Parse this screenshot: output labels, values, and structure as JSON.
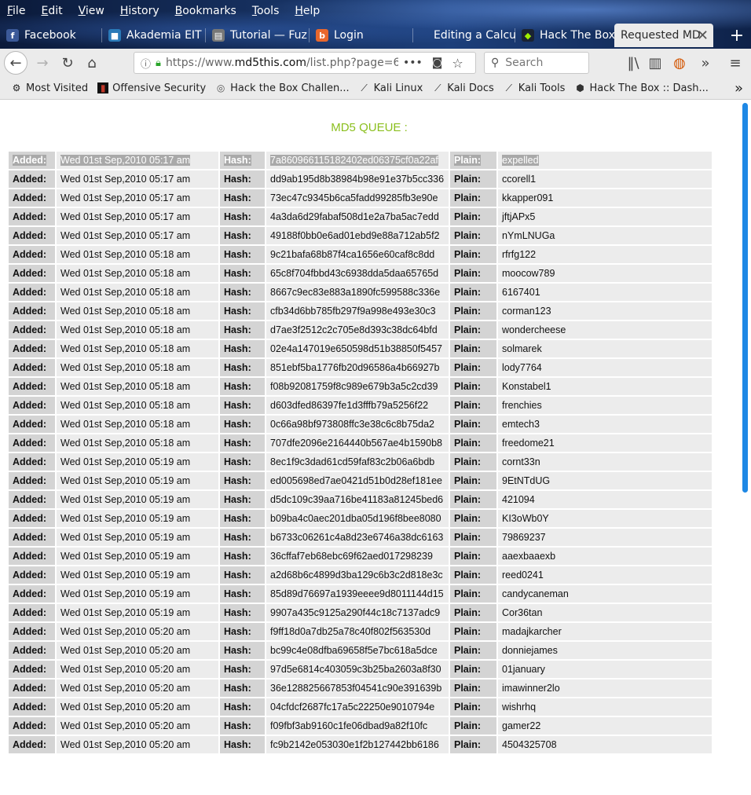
{
  "menu": [
    "File",
    "Edit",
    "View",
    "History",
    "Bookmarks",
    "Tools",
    "Help"
  ],
  "tabs": [
    {
      "label": "Facebook",
      "icon": "facebook-icon",
      "color": "#3b5998",
      "glyph": "f"
    },
    {
      "label": "Akademia EIT",
      "icon": "akademia-icon",
      "color": "#2a7ab8",
      "glyph": "■"
    },
    {
      "label": "Tutorial — Fuz",
      "icon": "tutorial-icon",
      "color": "#777777",
      "glyph": "▤"
    },
    {
      "label": "Login",
      "icon": "burp-icon",
      "color": "#e8672d",
      "glyph": "b"
    },
    {
      "label": "",
      "icon": "blank-tab-icon",
      "color": "#1d3f7a",
      "glyph": ""
    },
    {
      "label": "Editing a Calcu",
      "icon": "calc-icon",
      "color": "#1d3f7a",
      "glyph": ""
    },
    {
      "label": "Hack The Box",
      "icon": "htb-icon",
      "color": "#9fef00",
      "glyph": "◆"
    },
    {
      "label": "Requested MD",
      "icon": "page-icon",
      "color": "#ebebeb",
      "glyph": ""
    }
  ],
  "url": {
    "pre": "https://www.",
    "domain": "md5this.com",
    "path": "/list.php?page=6("
  },
  "search_placeholder": "Search",
  "bookmarks": [
    {
      "label": "Most Visited",
      "icon": "gear-icon"
    },
    {
      "label": "Offensive Security",
      "icon": "offsec-icon"
    },
    {
      "label": "Hack the Box Challen...",
      "icon": "globe-icon"
    },
    {
      "label": "Kali Linux",
      "icon": "kali-icon"
    },
    {
      "label": "Kali Docs",
      "icon": "kali-icon"
    },
    {
      "label": "Kali Tools",
      "icon": "kali-icon"
    },
    {
      "label": "Hack The Box :: Dash...",
      "icon": "htb-icon"
    }
  ],
  "heading": "MD5 QUEUE :",
  "labels": {
    "added": "Added:",
    "hash": "Hash:",
    "plain": "Plain:"
  },
  "rows": [
    [
      "Wed 01st Sep,2010 05:17 am",
      "7a860966115182402ed06375cf0a22af",
      "expelled"
    ],
    [
      "Wed 01st Sep,2010 05:17 am",
      "dd9ab195d8b38984b98e91e37b5cc336",
      "ccorell1"
    ],
    [
      "Wed 01st Sep,2010 05:17 am",
      "73ec47c9345b6ca5fadd99285fb3e90e",
      "kkapper091"
    ],
    [
      "Wed 01st Sep,2010 05:17 am",
      "4a3da6d29fabaf508d1e2a7ba5ac7edd",
      "jftjAPx5"
    ],
    [
      "Wed 01st Sep,2010 05:17 am",
      "49188f0bb0e6ad01ebd9e88a712ab5f2",
      "nYmLNUGa"
    ],
    [
      "Wed 01st Sep,2010 05:18 am",
      "9c21bafa68b87f4ca1656e60caf8c8dd",
      "rfrfg122"
    ],
    [
      "Wed 01st Sep,2010 05:18 am",
      "65c8f704fbbd43c6938dda5daa65765d",
      "moocow789"
    ],
    [
      "Wed 01st Sep,2010 05:18 am",
      "8667c9ec83e883a1890fc599588c336e",
      "6167401"
    ],
    [
      "Wed 01st Sep,2010 05:18 am",
      "cfb34d6bb785fb297f9a998e493e30c3",
      "corman123"
    ],
    [
      "Wed 01st Sep,2010 05:18 am",
      "d7ae3f2512c2c705e8d393c38dc64bfd",
      "wondercheese"
    ],
    [
      "Wed 01st Sep,2010 05:18 am",
      "02e4a147019e650598d51b38850f5457",
      "solmarek"
    ],
    [
      "Wed 01st Sep,2010 05:18 am",
      "851ebf5ba1776fb20d96586a4b66927b",
      "lody7764"
    ],
    [
      "Wed 01st Sep,2010 05:18 am",
      "f08b92081759f8c989e679b3a5c2cd39",
      "Konstabel1"
    ],
    [
      "Wed 01st Sep,2010 05:18 am",
      "d603dfed86397fe1d3fffb79a5256f22",
      "frenchies"
    ],
    [
      "Wed 01st Sep,2010 05:18 am",
      "0c66a98bf973808ffc3e38c6c8b75da2",
      "emtech3"
    ],
    [
      "Wed 01st Sep,2010 05:18 am",
      "707dfe2096e2164440b567ae4b1590b8",
      "freedome21"
    ],
    [
      "Wed 01st Sep,2010 05:19 am",
      "8ec1f9c3dad61cd59faf83c2b06a6bdb",
      "cornt33n"
    ],
    [
      "Wed 01st Sep,2010 05:19 am",
      "ed005698ed7ae0421d51b0d28ef181ee",
      "9EtNTdUG"
    ],
    [
      "Wed 01st Sep,2010 05:19 am",
      "d5dc109c39aa716be41183a81245bed6",
      "421094"
    ],
    [
      "Wed 01st Sep,2010 05:19 am",
      "b09ba4c0aec201dba05d196f8bee8080",
      "KI3oWb0Y"
    ],
    [
      "Wed 01st Sep,2010 05:19 am",
      "b6733c06261c4a8d23e6746a38dc6163",
      "79869237"
    ],
    [
      "Wed 01st Sep,2010 05:19 am",
      "36cffaf7eb68ebc69f62aed017298239",
      "aaexbaaexb"
    ],
    [
      "Wed 01st Sep,2010 05:19 am",
      "a2d68b6c4899d3ba129c6b3c2d818e3c",
      "reed0241"
    ],
    [
      "Wed 01st Sep,2010 05:19 am",
      "85d89d76697a1939eeee9d8011144d15",
      "candycaneman"
    ],
    [
      "Wed 01st Sep,2010 05:19 am",
      "9907a435c9125a290f44c18c7137adc9",
      "Cor36tan"
    ],
    [
      "Wed 01st Sep,2010 05:20 am",
      "f9ff18d0a7db25a78c40f802f563530d",
      "madajkarcher"
    ],
    [
      "Wed 01st Sep,2010 05:20 am",
      "bc99c4e08dfba69658f5e7bc618a5dce",
      "donniejames"
    ],
    [
      "Wed 01st Sep,2010 05:20 am",
      "97d5e6814c403059c3b25ba2603a8f30",
      "01january"
    ],
    [
      "Wed 01st Sep,2010 05:20 am",
      "36e128825667853f04541c90e391639b",
      "imawinner2lo"
    ],
    [
      "Wed 01st Sep,2010 05:20 am",
      "04cfdcf2687fc17a5c22250e9010794e",
      "wishrhq"
    ],
    [
      "Wed 01st Sep,2010 05:20 am",
      "f09fbf3ab9160c1fe06dbad9a82f10fc",
      "gamer22"
    ],
    [
      "Wed 01st Sep,2010 05:20 am",
      "fc9b2142e053030e1f2b127442bb6186",
      "4504325708"
    ]
  ]
}
